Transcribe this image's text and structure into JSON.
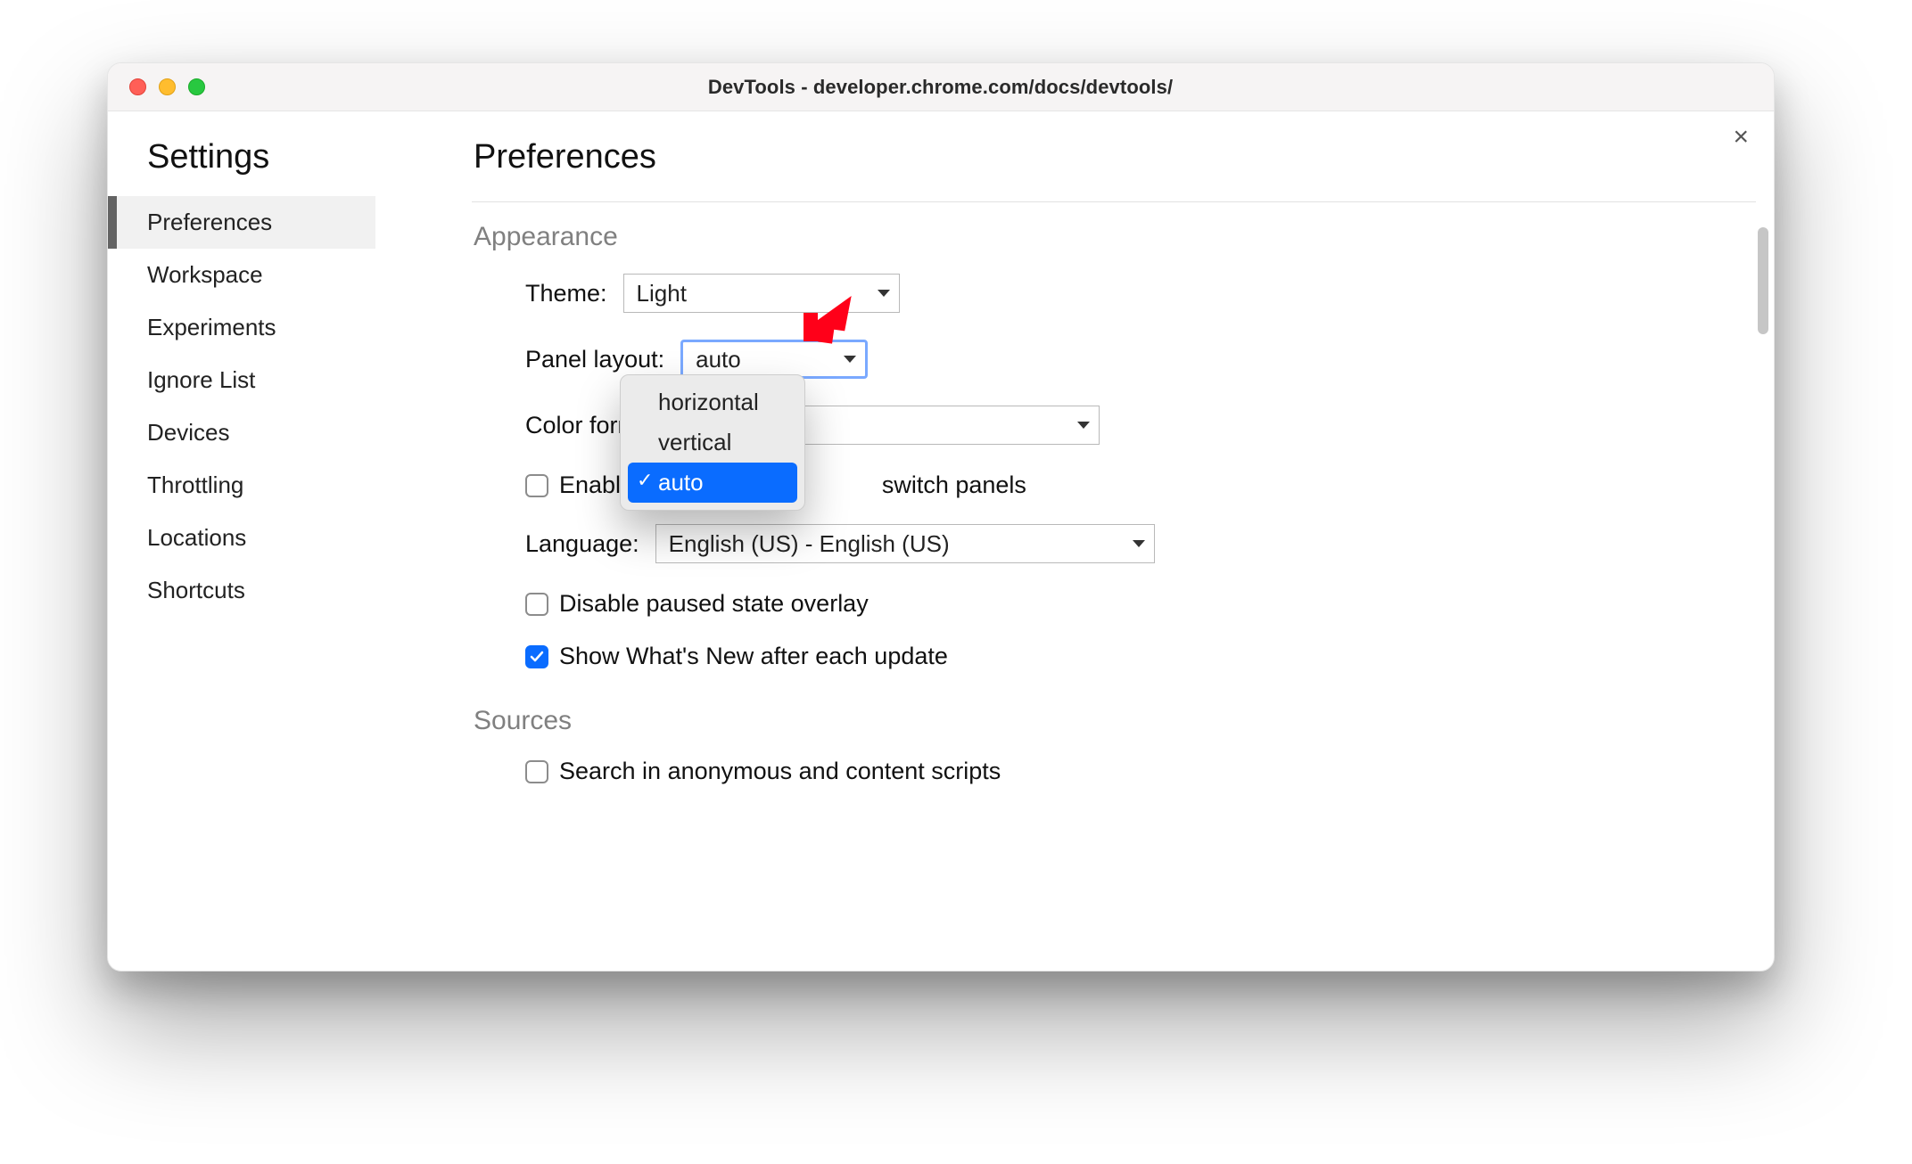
{
  "window": {
    "title": "DevTools - developer.chrome.com/docs/devtools/"
  },
  "sidebar": {
    "heading": "Settings",
    "items": [
      {
        "label": "Preferences",
        "active": true
      },
      {
        "label": "Workspace",
        "active": false
      },
      {
        "label": "Experiments",
        "active": false
      },
      {
        "label": "Ignore List",
        "active": false
      },
      {
        "label": "Devices",
        "active": false
      },
      {
        "label": "Throttling",
        "active": false
      },
      {
        "label": "Locations",
        "active": false
      },
      {
        "label": "Shortcuts",
        "active": false
      }
    ]
  },
  "page": {
    "title": "Preferences",
    "sections": {
      "appearance": {
        "heading": "Appearance",
        "theme_label": "Theme:",
        "theme_value": "Light",
        "panel_layout_label": "Panel layout:",
        "panel_layout_value": "auto",
        "panel_layout_options": [
          "horizontal",
          "vertical",
          "auto"
        ],
        "panel_layout_selected": "auto",
        "color_format_label": "Color format:",
        "color_format_value": "",
        "enable_shortcut_pre": "Enable ⌘ +",
        "enable_shortcut_post": " switch panels",
        "enable_shortcut_checked": false,
        "language_label": "Language:",
        "language_value": "English (US) - English (US)",
        "disable_overlay_label": "Disable paused state overlay",
        "disable_overlay_checked": false,
        "show_whats_new_label": "Show What's New after each update",
        "show_whats_new_checked": true
      },
      "sources": {
        "heading": "Sources",
        "search_anon_label": "Search in anonymous and content scripts",
        "search_anon_checked": false
      }
    }
  },
  "annotation": {
    "arrow_color": "#ff0019"
  }
}
